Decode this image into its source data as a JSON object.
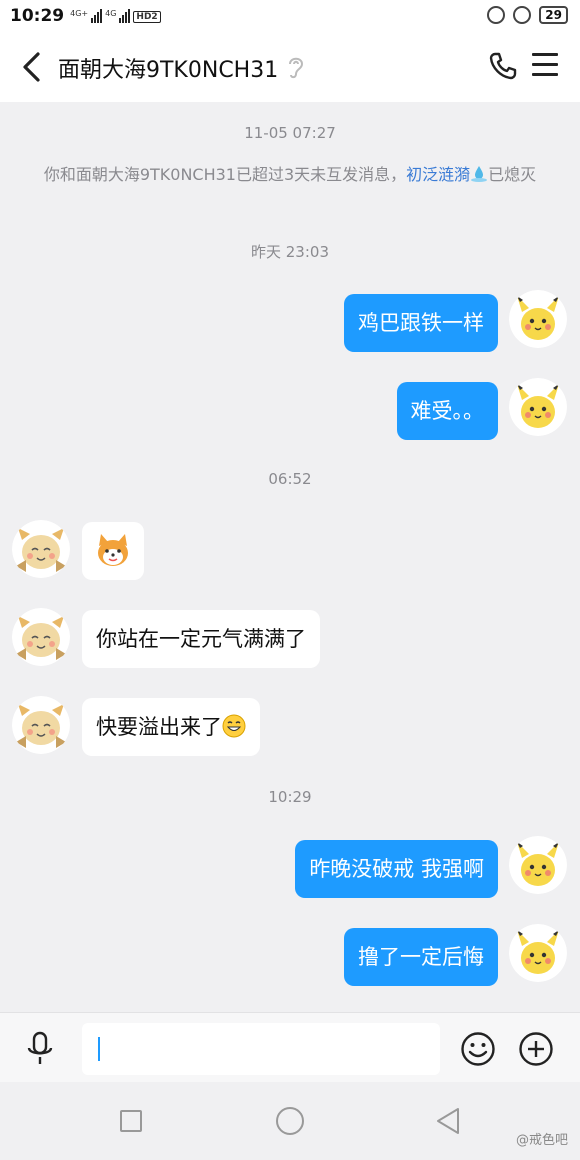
{
  "status_bar": {
    "time": "10:29",
    "network1": "4G+",
    "network2": "4G",
    "hd": "HD2",
    "battery": "29"
  },
  "header": {
    "title": "面朝大海9TK0NCH31"
  },
  "chat": {
    "timestamps": [
      "11-05 07:27",
      "昨天 23:03",
      "06:52",
      "10:29"
    ],
    "system_message": {
      "text_before": "你和面朝大海9TK0NCH31已超过3天未互发消息，",
      "link": "初泛涟漪",
      "text_after": "已熄灭"
    },
    "messages": [
      {
        "side": "out",
        "text": "鸡巴跟铁一样"
      },
      {
        "side": "out",
        "text": "难受。。"
      },
      {
        "side": "in",
        "text": "",
        "sticker": "shiba-sticker"
      },
      {
        "side": "in",
        "text": "你站在一定元气满满了"
      },
      {
        "side": "in",
        "text": "快要溢出来了"
      },
      {
        "side": "out",
        "text": "昨晚没破戒  我强啊"
      },
      {
        "side": "out",
        "text": "撸了一定后悔"
      }
    ]
  },
  "input_bar": {
    "placeholder": ""
  },
  "watermark": "@戒色吧",
  "icons": {
    "back": "chevron-left-icon",
    "ear": "ear-icon",
    "phone": "phone-icon",
    "menu": "menu-icon",
    "mic": "mic-icon",
    "emoji": "smiley-icon",
    "plus": "plus-circle-icon"
  },
  "colors": {
    "out_bubble": "#1e9bff",
    "in_bubble": "#ffffff",
    "link": "#3a7bd5",
    "background": "#f0f0f2"
  }
}
